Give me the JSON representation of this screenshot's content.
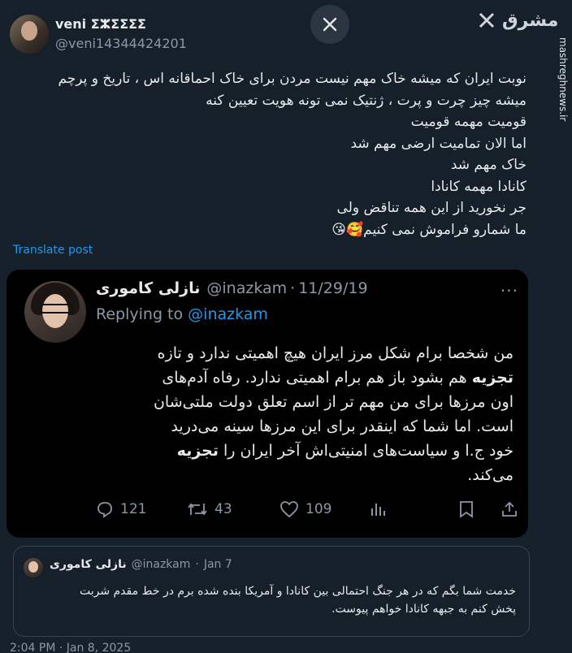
{
  "post": {
    "display_name": "veni ⵉⵣⵉⵉⵉⵉ",
    "handle": "@veni14344424201",
    "text_lines": [
      "نوبت ایران که میشه خاک مهم نیست مردن برای خاک احماقانه اس ، تاریخ و پرچم",
      "میشه چیز چرت و پرت ، ژنتیک نمی تونه هویت تعیین کنه",
      "قومیت مهمه قومیت",
      "اما الان تمامیت ارضی مهم شد",
      "خاک مهم شد",
      "کانادا مهمه کانادا",
      "جر نخورید از این همه تناقض ولی",
      "ما شمارو فراموش نمی کنیم🥰😘"
    ],
    "translate_label": "Translate post"
  },
  "brand": {
    "name": "مشرق",
    "url": "mashreghnews.ir"
  },
  "quoted": {
    "display_name": "نازلی کاموری",
    "handle": "@inazkam",
    "separator": "·",
    "date": "11/29/19",
    "replying_prefix": "Replying to",
    "replying_handle": "@inazkam",
    "more": "···",
    "text_lines": [
      {
        "pre": "من شخصا برام شکل مرز ایران هیچ اهمیتی ندارد و تازه",
        "bold": "",
        "post": ""
      },
      {
        "pre": "",
        "bold": "تجزیه",
        "post": " هم بشود باز هم برام اهمیتی ندارد. رفاه آدم‌های"
      },
      {
        "pre": "اون مرزها برای من مهم تر از اسم تعلق دولت ملتی‌شان",
        "bold": "",
        "post": ""
      },
      {
        "pre": "است. اما شما که اینقدر برای این مرزها سینه می‌درید",
        "bold": "",
        "post": ""
      },
      {
        "pre": "خود ج.ا و سیاست‌های امنیتی‌اش آخر ایران را ",
        "bold": "تجزیه",
        "post": ""
      },
      {
        "pre": "می‌کند.",
        "bold": "",
        "post": ""
      }
    ],
    "stats": {
      "replies": "121",
      "reposts": "43",
      "likes": "109"
    }
  },
  "reply": {
    "display_name": "نازلی کاموری",
    "handle": "@inazkam",
    "separator": "·",
    "date": "Jan 7",
    "text_lines": [
      "خدمت شما بگم که در هر جنگ احتمالی بین کانادا و آمریکا بنده شده برم در خط مقدم شربت",
      "پخش کنم به جبهه کانادا خواهم پیوست."
    ]
  },
  "footer": {
    "timestamp_partial": "2:04 PM · Jan 8, 2025"
  },
  "colors": {
    "background": "#15202b",
    "card": "#000000",
    "accent": "#1d9bf0",
    "muted": "#8b98a5"
  }
}
